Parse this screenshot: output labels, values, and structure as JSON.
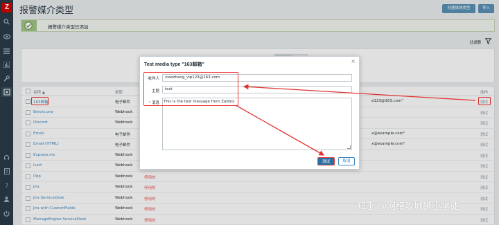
{
  "app": {
    "logo_letter": "Z"
  },
  "header": {
    "title": "报警媒介类型",
    "create_button": "创建媒体类型",
    "import_button": "导入"
  },
  "message": {
    "text": "报警媒介类型已添加"
  },
  "filter": {
    "label": "过滤器"
  },
  "table": {
    "columns": {
      "name": "名称 ▲",
      "type": "类型",
      "action": "动作"
    },
    "rows": [
      {
        "name": "163邮箱",
        "type": "电子邮件",
        "status": "",
        "detail": "e123@163.com\"",
        "action": "测试"
      },
      {
        "name": "Brevis.one",
        "type": "Webhook",
        "status": "",
        "detail": "",
        "action": "测试"
      },
      {
        "name": "Discord",
        "type": "Webhook",
        "status": "",
        "detail": "",
        "action": "测试"
      },
      {
        "name": "Email",
        "type": "电子邮件",
        "status": "",
        "detail": "x@example.com\"",
        "action": "测试"
      },
      {
        "name": "Email (HTML)",
        "type": "电子邮件",
        "status": "",
        "detail": "x@example.com\"",
        "action": "测试"
      },
      {
        "name": "Express.ms",
        "type": "Webhook",
        "status": "",
        "detail": "",
        "action": "测试"
      },
      {
        "name": "iLert",
        "type": "Webhook",
        "status": "",
        "detail": "",
        "action": "测试"
      },
      {
        "name": "iTop",
        "type": "Webhook",
        "status": "停用的",
        "detail": "",
        "action": "测试"
      },
      {
        "name": "Jira",
        "type": "Webhook",
        "status": "停用的",
        "detail": "",
        "action": "测试"
      },
      {
        "name": "Jira ServiceDesk",
        "type": "Webhook",
        "status": "停用的",
        "detail": "",
        "action": "测试"
      },
      {
        "name": "Jira with CustomFields",
        "type": "Webhook",
        "status": "停用的",
        "detail": "",
        "action": "测试"
      },
      {
        "name": "ManageEngine ServiceDesk",
        "type": "Webhook",
        "status": "停用的",
        "detail": "",
        "action": "测试"
      }
    ]
  },
  "modal": {
    "title": "Test media type \"163邮箱\"",
    "close": "×",
    "recipient_label": "收件人",
    "recipient_value": "xiaozhang_vip123@163.com",
    "subject_label": "主题",
    "subject_value": "test",
    "message_label": "消息",
    "message_value": "This is the test message from Zabbix",
    "test_button": "测试",
    "cancel_button": "取消"
  },
  "watermark": "知乎 @网络攻城狮小学徒",
  "colors": {
    "sidebar": "#2b3c48",
    "logo": "#d40000",
    "link": "#3d88c2",
    "primary_button": "#2b6fa3",
    "annotation": "#e33333",
    "success_bar": "#a2c588"
  }
}
